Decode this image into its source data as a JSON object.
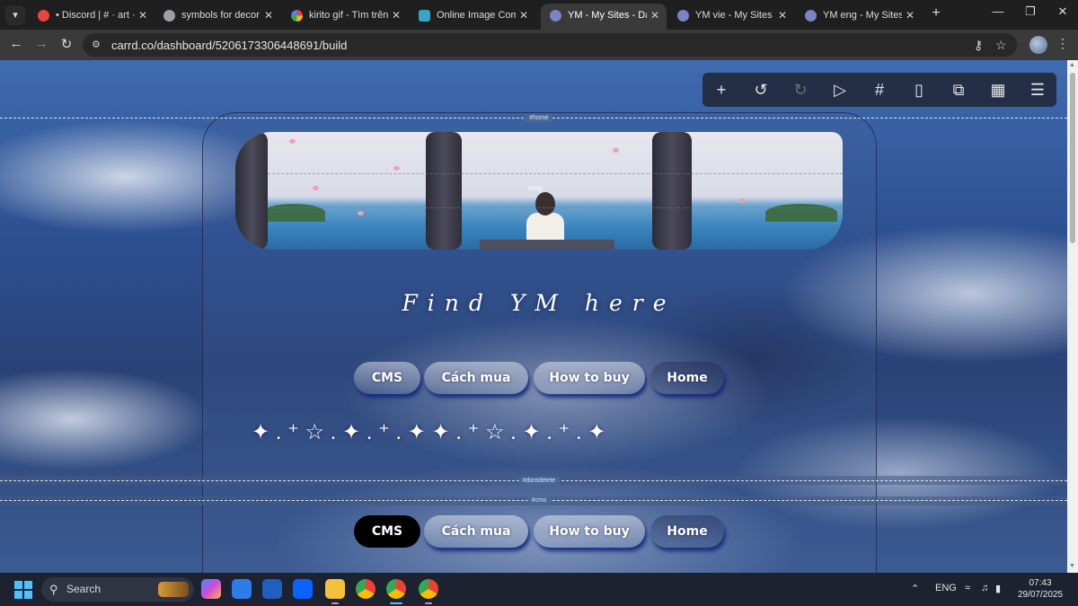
{
  "browser": {
    "tabs": [
      {
        "title": "• Discord | # · art · cö",
        "favicon_color": "#e8453c",
        "active": false
      },
      {
        "title": "symbols for decor",
        "favicon_color": "#9aa0a6",
        "active": false
      },
      {
        "title": "kirito gif - Tìm trên G",
        "favicon_color": "#4285f4",
        "active": false
      },
      {
        "title": "Online Image Compr",
        "favicon_color": "#35a7c4",
        "active": false
      },
      {
        "title": "YM - My Sites - Dash",
        "favicon_color": "#7c83c4",
        "active": true
      },
      {
        "title": "YM vie - My Sites - D",
        "favicon_color": "#7c83c4",
        "active": false
      },
      {
        "title": "YM eng - My Sites - D",
        "favicon_color": "#7c83c4",
        "active": false
      }
    ],
    "url": "carrd.co/dashboard/5206173306448691/build"
  },
  "sections": {
    "home_tag": "#home",
    "dontdelete_tag": "#dontdelete",
    "cms_tag": "#cms"
  },
  "banner": {
    "label": "Emty"
  },
  "page": {
    "heading": "Find YM here",
    "nav_buttons": [
      "CMS",
      "Cách mua",
      "How to buy",
      "Home"
    ],
    "sparkle_row": "✦ .  ⁺ ☆ . ✦ .  ⁺   . ✦ ✦ .  ⁺ ☆ . ✦ .  ⁺   . ✦",
    "cms_nav_buttons": [
      "CMS",
      "Cách mua",
      "How to buy",
      "Home"
    ]
  },
  "editor_toolbar": {
    "icons": [
      "add-icon",
      "undo-icon",
      "redo-icon",
      "play-icon",
      "hash-icon",
      "mobile-icon",
      "external-link-icon",
      "save-icon",
      "menu-icon"
    ]
  },
  "taskbar": {
    "search_placeholder": "Search",
    "language": "ENG",
    "time": "07:43",
    "date": "29/07/2025"
  }
}
